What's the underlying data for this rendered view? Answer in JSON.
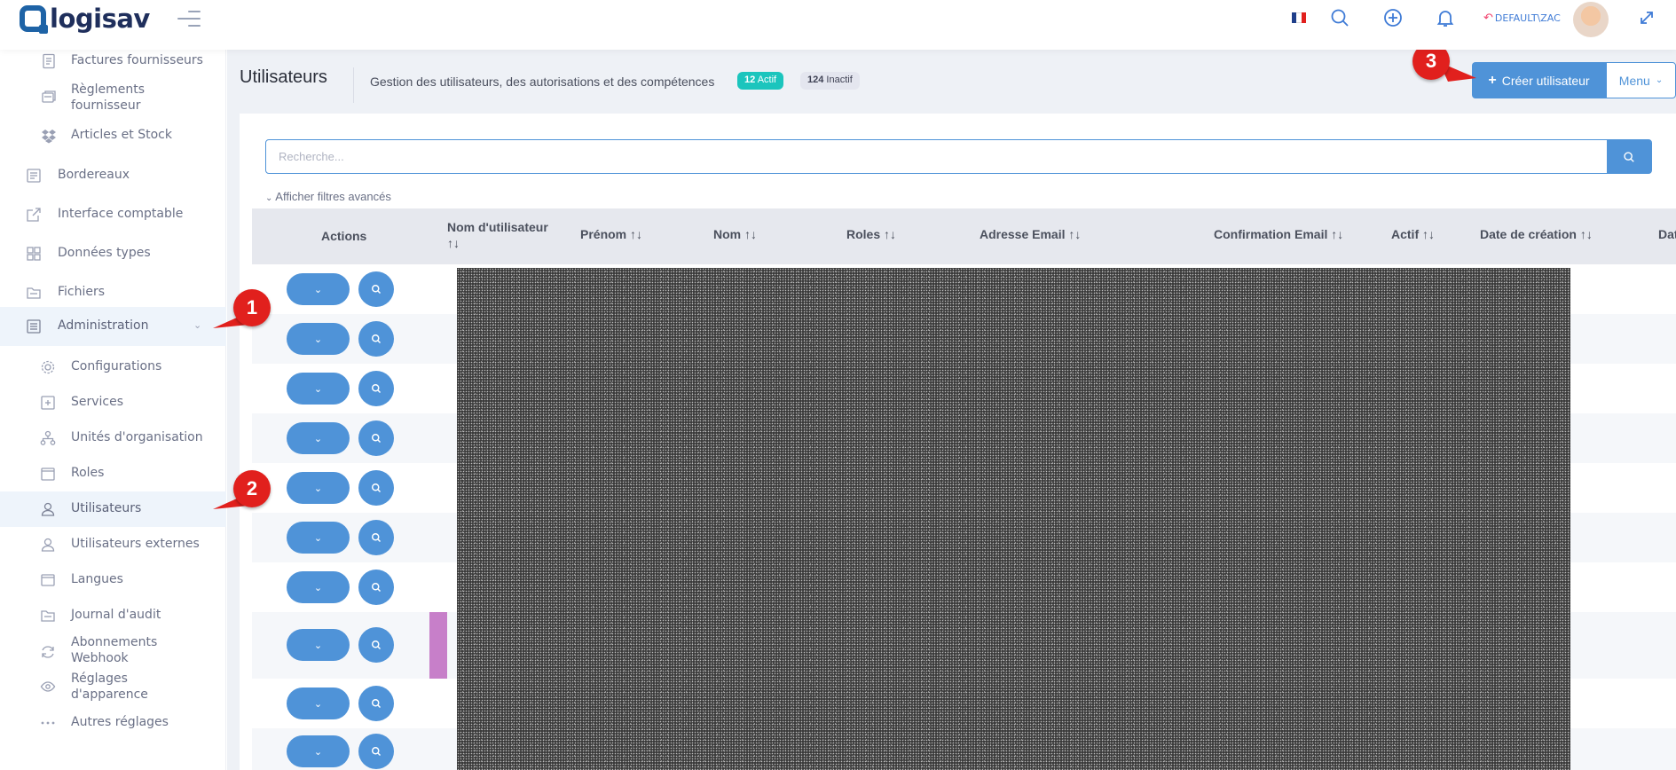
{
  "topbar": {
    "logo_text": "logisav",
    "user_label": "DEFAULT\\ZAC",
    "flag_colors": [
      "#1f3f8a",
      "#ffffff",
      "#e1201d"
    ]
  },
  "sidebar": {
    "items": [
      {
        "label": "Factures fournisseurs",
        "icon": "invoice-icon"
      },
      {
        "label": "Règlements fournisseur",
        "icon": "payments-icon"
      },
      {
        "label": "Articles et Stock",
        "icon": "dropbox-icon"
      },
      {
        "label": "Bordereaux",
        "icon": "notebook-icon"
      },
      {
        "label": "Interface comptable",
        "icon": "external-link-icon"
      },
      {
        "label": "Données types",
        "icon": "grid-icon"
      },
      {
        "label": "Fichiers",
        "icon": "folder-icon"
      },
      {
        "label": "Administration",
        "icon": "admin-icon"
      },
      {
        "label": "Configurations",
        "icon": "gear-icon"
      },
      {
        "label": "Services",
        "icon": "services-icon"
      },
      {
        "label": "Unités d'organisation",
        "icon": "org-units-icon"
      },
      {
        "label": "Roles",
        "icon": "roles-icon"
      },
      {
        "label": "Utilisateurs",
        "icon": "user-icon"
      },
      {
        "label": "Utilisateurs externes",
        "icon": "external-user-icon"
      },
      {
        "label": "Langues",
        "icon": "languages-icon"
      },
      {
        "label": "Journal d'audit",
        "icon": "audit-log-icon"
      },
      {
        "label": "Abonnements Webhook",
        "icon": "webhook-icon"
      },
      {
        "label": "Réglages d'apparence",
        "icon": "eye-icon"
      },
      {
        "label": "Autres réglages",
        "icon": "dots-icon"
      }
    ]
  },
  "header": {
    "title": "Utilisateurs",
    "subtitle": "Gestion des utilisateurs, des autorisations et des compétences",
    "active_badge_count": "12",
    "active_badge_label": "Actif",
    "inactive_badge_count": "124",
    "inactive_badge_label": "Inactif",
    "create_button_label": "Créer utilisateur",
    "menu_button_label": "Menu"
  },
  "search": {
    "placeholder": "Recherche...",
    "advanced_filters_label": "Afficher filtres avancés"
  },
  "table": {
    "columns": [
      "Actions",
      "Nom d'utilisateur",
      "Prénom",
      "Nom",
      "Roles",
      "Adresse Email",
      "Confirmation Email",
      "Actif",
      "Date de création",
      "Dat"
    ],
    "sort_icon": "↑↓",
    "row_count": 10
  },
  "annotations": {
    "markers": [
      "1",
      "2",
      "3"
    ],
    "marker_color": "#e1201d"
  },
  "colors": {
    "primary": "#4f93d8",
    "success": "#1bc5bd",
    "highlight_bar": "#c77fc9"
  }
}
